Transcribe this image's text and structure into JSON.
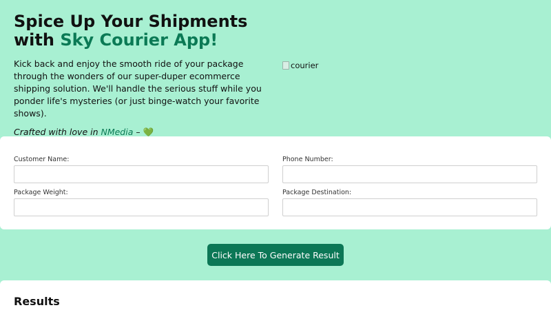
{
  "hero": {
    "title_line1": "Spice Up Your Shipments",
    "title_prefix": "with ",
    "title_brand": "Sky Courier App!",
    "description": "Kick back and enjoy the smooth ride of your package through the wonders of our super-duper ecommerce shipping solution. We'll handle the serious stuff while you ponder life's mysteries (or just binge-watch your favorite shows).",
    "credit_prefix": "Crafted with love in ",
    "credit_link": "NMedia",
    "credit_suffix": " – ",
    "credit_heart": "💚",
    "image_alt": "courier"
  },
  "form": {
    "customer_name_label": "Customer Name:",
    "customer_name_value": "",
    "phone_label": "Phone Number:",
    "phone_value": "",
    "weight_label": "Package Weight:",
    "weight_value": "",
    "destination_label": "Package Destination:",
    "destination_value": ""
  },
  "actions": {
    "generate_label": "Click Here To Generate Result"
  },
  "results": {
    "heading": "Results"
  },
  "colors": {
    "background": "#a8f0d2",
    "brand": "#0b7a55",
    "button": "#0c7756"
  }
}
